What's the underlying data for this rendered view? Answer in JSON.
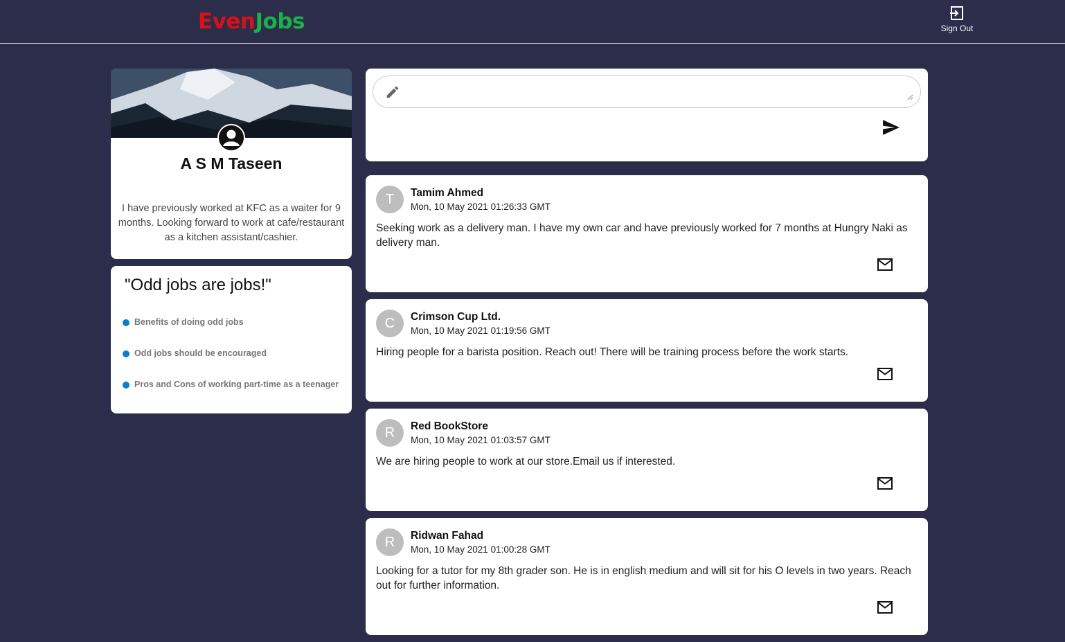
{
  "brand": {
    "part1": "Even",
    "part2": "Jobs",
    "color1": "#d9101a",
    "color2": "#1ab04a"
  },
  "header": {
    "signout_label": "Sign Out",
    "signout_icon": "logout-icon"
  },
  "profile": {
    "name": "A S M Taseen",
    "bio": "I have previously worked at KFC as a waiter for 9 months. Looking forward to work at cafe/restaurant as a kitchen assistant/cashier."
  },
  "odd_jobs": {
    "title": "\"Odd jobs are jobs!\"",
    "items": [
      "Benefits of doing odd jobs",
      "Odd jobs should be encouraged",
      "Pros and Cons of working part-time as a teenager"
    ]
  },
  "composer": {
    "placeholder": "",
    "icon": "pencil-icon",
    "send_icon": "send-icon"
  },
  "posts": [
    {
      "initial": "T",
      "author": "Tamim Ahmed",
      "time": "Mon, 10 May 2021 01:26:33 GMT",
      "body": "Seeking work as a delivery man. I have my own car and have previously worked for 7 months at Hungry Naki as delivery man."
    },
    {
      "initial": "C",
      "author": "Crimson Cup Ltd.",
      "time": "Mon, 10 May 2021 01:19:56 GMT",
      "body": "Hiring people for a barista position. Reach out! There will be training process before the work starts."
    },
    {
      "initial": "R",
      "author": "Red BookStore",
      "time": "Mon, 10 May 2021 01:03:57 GMT",
      "body": "We are hiring people to work at our store.Email us if interested."
    },
    {
      "initial": "R",
      "author": "Ridwan Fahad",
      "time": "Mon, 10 May 2021 01:00:28 GMT",
      "body": "Looking for a tutor for my 8th grader son. He is in english medium and will sit for his O levels in two years. Reach out for further information."
    }
  ],
  "colors": {
    "background": "#2c2d4a",
    "bullet": "#0a7fc9",
    "avatar_bg": "#bdbdbd"
  }
}
